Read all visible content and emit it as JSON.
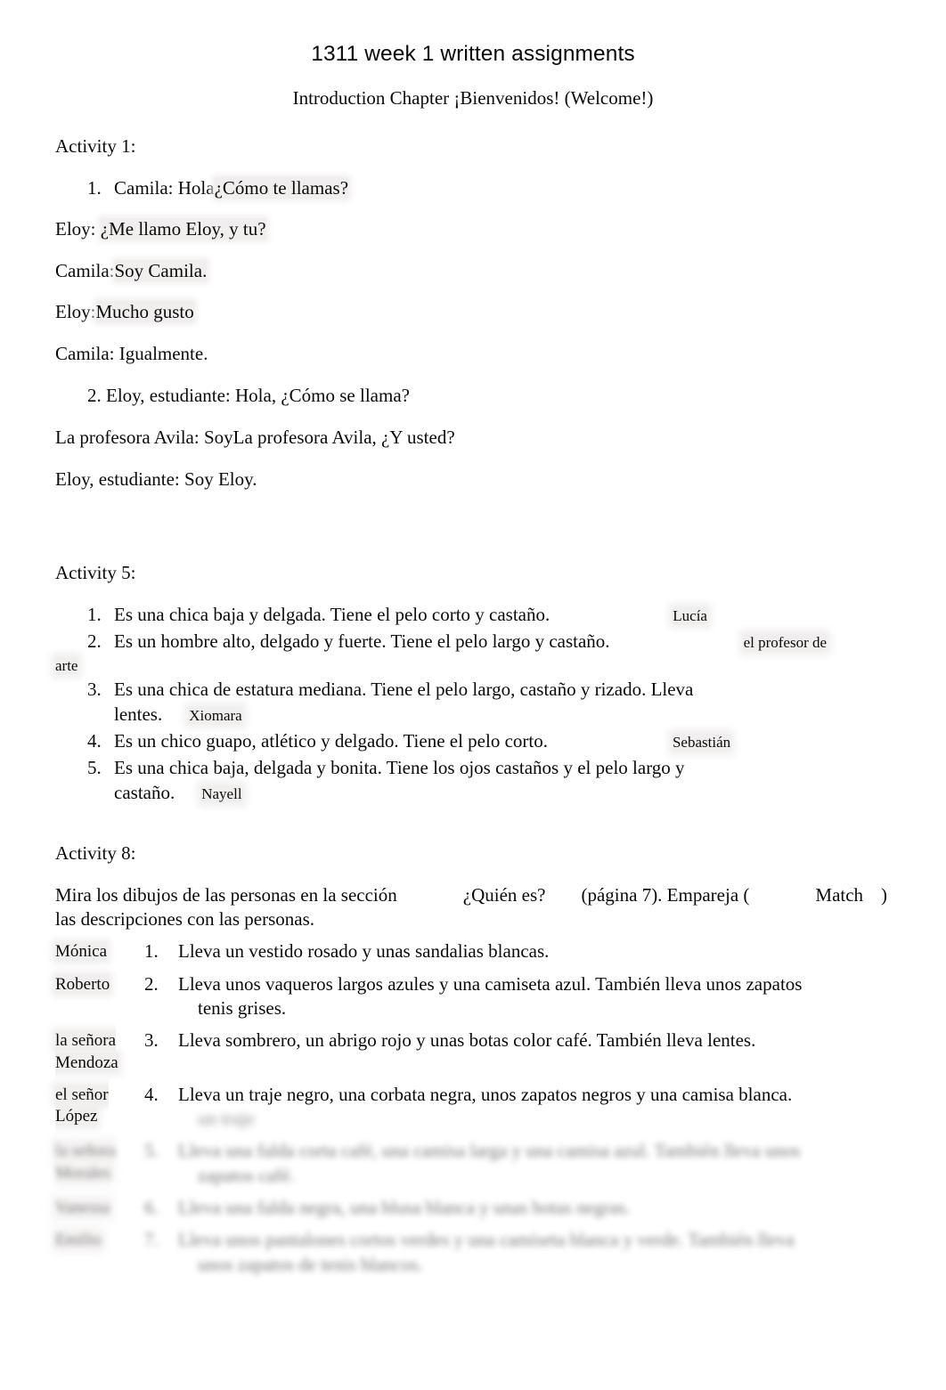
{
  "document": {
    "title": "1311 week 1 written assignments",
    "subtitle": "Introduction Chapter ¡Bienvenidos! (Welcome!)"
  },
  "activity1": {
    "heading": "Activity 1:",
    "item1_num": "1.",
    "item1_prompt": "Camila: Hola",
    "item1_answer": "¿Cómo te llamas?",
    "line2_speaker": "Eloy:",
    "line2_answer": "¿Me llamo Eloy, y tu?",
    "line3_speaker": "Camila:",
    "line3_answer": "Soy Camila.",
    "line4_speaker": "Eloy:",
    "line4_answer": "Mucho gusto",
    "line5_speaker": "Camila:",
    "line5_text": "Igualmente.",
    "item2_num": "2.",
    "item2_text": "Eloy, estudiante: Hola, ¿Cómo se llama?",
    "line6_speaker": "La profesora Avila: Soy",
    "line6_answer": "La profesora Avila, ¿Y usted?",
    "line7_speaker": "Eloy, estudiante:",
    "line7_answer": "Soy Eloy."
  },
  "activity5": {
    "heading": "Activity 5:",
    "items": [
      {
        "num": "1.",
        "text": "Es una chica baja y delgada. Tiene el pelo corto y castaño.",
        "answer": "Lucía"
      },
      {
        "num": "2.",
        "text": "Es un hombre alto, delgado y fuerte. Tiene el pelo largo y castaño.",
        "answer": "el profesor de",
        "answer_wrap": "arte"
      },
      {
        "num": "3.",
        "text": "Es una chica de estatura mediana. Tiene el pelo largo, castaño y rizado. Lleva",
        "text_cont": "lentes.",
        "answer": "Xiomara"
      },
      {
        "num": "4.",
        "text": "Es un chico guapo, atlético y delgado. Tiene el pelo corto.",
        "answer": "Sebastián"
      },
      {
        "num": "5.",
        "text": "Es una chica baja, delgada y bonita. Tiene los ojos castaños y el pelo largo y",
        "text_cont": "castaño.",
        "answer": "Nayell"
      }
    ]
  },
  "activity8": {
    "heading": "Activity 8:",
    "instruction_part1": "Mira los dibujos de las personas en la sección",
    "instruction_section": "¿Quién es?",
    "instruction_part2": "(página 7). Empareja (",
    "instruction_match": "Match",
    "instruction_part3": ")",
    "instruction_line2": "las descripciones con las personas.",
    "rows": [
      {
        "name": "Mónica",
        "num": "1.",
        "text": "Lleva un vestido rosado y unas sandalias blancas.",
        "blurred": false
      },
      {
        "name": "Roberto",
        "num": "2.",
        "text": "Lleva unos vaqueros largos azules y una camiseta azul. También lleva unos zapatos",
        "text_cont": "tenis grises.",
        "blurred": false
      },
      {
        "name": "la señora Mendoza",
        "num": "3.",
        "text": "Lleva sombrero, un abrigo rojo y unas botas color café. También lleva lentes.",
        "blurred": false
      },
      {
        "name": "el señor López",
        "num": "4.",
        "text": "Lleva un traje negro, una corbata negra, unos zapatos negros y una camisa blanca.",
        "blurred": false
      },
      {
        "name": "la señora Morales",
        "num": "5.",
        "text": "Lleva una falda corta café, una camisa larga y una camisa azul. También lleva unos",
        "text_cont": "zapatos café.",
        "blurred": true
      },
      {
        "name": "Vanessa",
        "num": "6.",
        "text": "Lleva una falda negra, una blusa blanca y unas botas negras.",
        "blurred": true
      },
      {
        "name": "Emilio",
        "num": "7.",
        "text": "Lleva unos pantalones cortos verdes y una camiseta blanca y verde. También lleva",
        "text_cont": "unos zapatos de tenis blancos.",
        "blurred": true
      }
    ],
    "answer_blurred_row4": "un traje"
  }
}
